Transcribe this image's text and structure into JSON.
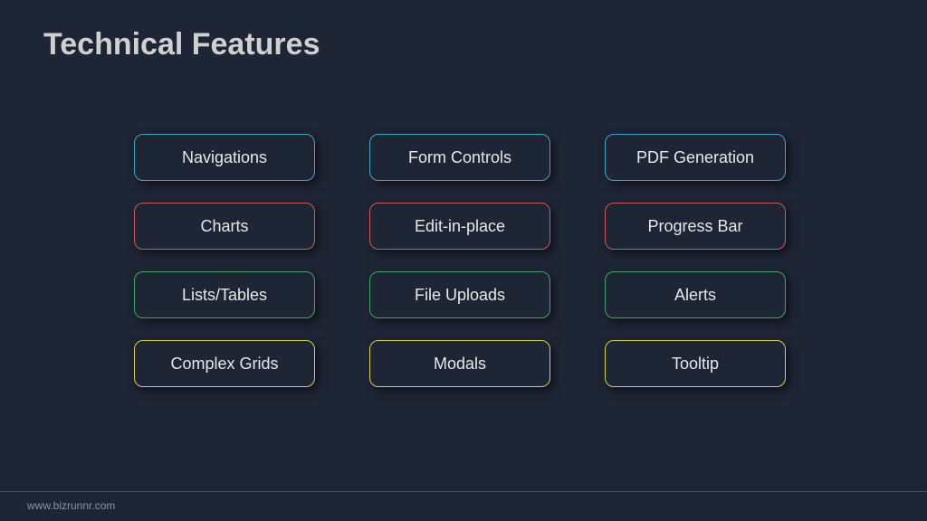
{
  "title": "Technical Features",
  "features": {
    "row1": {
      "col1": "Navigations",
      "col2": "Form Controls",
      "col3": "PDF Generation"
    },
    "row2": {
      "col1": "Charts",
      "col2": "Edit-in-place",
      "col3": "Progress Bar"
    },
    "row3": {
      "col1": "Lists/Tables",
      "col2": "File Uploads",
      "col3": "Alerts"
    },
    "row4": {
      "col1": "Complex Grids",
      "col2": "Modals",
      "col3": "Tooltip"
    }
  },
  "footer": "www.bizrunnr.com",
  "colors": {
    "cyan": "#3da6c4",
    "red": "#d15a5a",
    "green": "#3ea668",
    "yellow": "#d8d048",
    "background": "#1e2535"
  }
}
